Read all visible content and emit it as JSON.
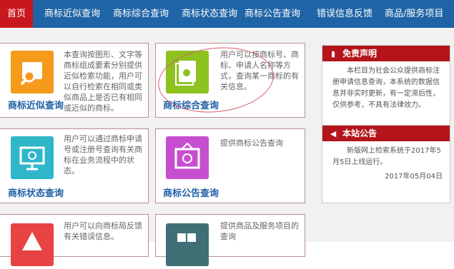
{
  "nav": {
    "items": [
      "首页",
      "商标近似查询",
      "商标综合查询",
      "商标状态查询",
      "商标公告查询",
      "错误信息反馈",
      "商品/服务项目"
    ]
  },
  "cards": [
    {
      "title": "商标近似查询",
      "desc": "本查询按图形、文字等商标组成要素分别提供近似检索功能，用户可以自行检索在相同或类似商品上是否已有相同或近似的商标。",
      "color": "#f59a1a",
      "icon": "folder-search-icon"
    },
    {
      "title": "商标综合查询",
      "desc": "用户可以按商标号、商标、申请人名称等方式，查询某一商标的有关信息。",
      "color": "#8dc21f",
      "icon": "document-search-icon"
    },
    {
      "title": "商标状态查询",
      "desc": "用户可以通过商标申请号或注册号查询有关商标在业务流程中的状态。",
      "color": "#2fb7c9",
      "icon": "monitor-search-icon"
    },
    {
      "title": "商标公告查询",
      "desc": "提供商标公告查询",
      "color": "#c64fd0",
      "icon": "frame-search-icon"
    },
    {
      "title": "",
      "desc": "用户可以向商标局反馈有关错误信息。",
      "color": "#e84343",
      "icon": "warning-icon"
    },
    {
      "title": "",
      "desc": "提供商品及服务项目的查询",
      "color": "#3f6f75",
      "icon": "grid-icon"
    }
  ],
  "sidebar": {
    "disclaimer": {
      "title": "免责声明",
      "text": "本栏目为社会公众提供商标注册申请信息查询，本系统的数据信息并非实时更新，有一定滞后性，仅供参考，不具有法律效力。"
    },
    "notice": {
      "title": "本站公告",
      "text": "新版网上检索系统于2017年5月5日上线运行。",
      "date": "2017年05月04日"
    }
  },
  "colors": {
    "nav": "#1f64a6",
    "home": "#c9171e",
    "side_head": "#b3151a",
    "title": "#1f5fa5"
  }
}
